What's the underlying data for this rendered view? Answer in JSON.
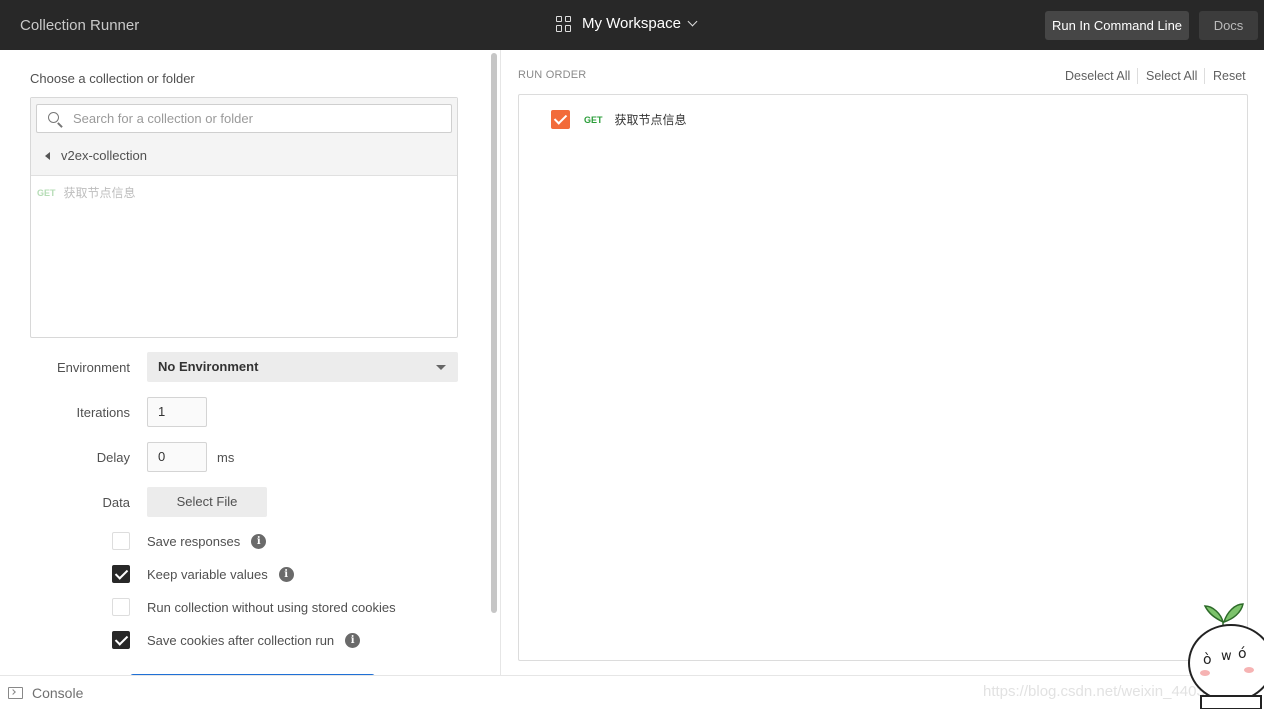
{
  "header": {
    "app_title": "Collection Runner",
    "workspace": "My Workspace",
    "run_cli": "Run In Command Line",
    "docs": "Docs"
  },
  "left": {
    "choose_label": "Choose a collection or folder",
    "search_placeholder": "Search for a collection or folder",
    "collection_name": "v2ex-collection",
    "request": {
      "method": "GET",
      "name": "获取节点信息"
    },
    "environment_label": "Environment",
    "environment_value": "No Environment",
    "iterations_label": "Iterations",
    "iterations_value": "1",
    "delay_label": "Delay",
    "delay_value": "0",
    "delay_unit": "ms",
    "data_label": "Data",
    "select_file": "Select File",
    "options": [
      {
        "label": "Save responses",
        "checked": false,
        "info": true
      },
      {
        "label": "Keep variable values",
        "checked": true,
        "info": true
      },
      {
        "label": "Run collection without using stored cookies",
        "checked": false,
        "info": false
      },
      {
        "label": "Save cookies after collection run",
        "checked": true,
        "info": true
      }
    ],
    "info_glyph": "i"
  },
  "right": {
    "run_order_label": "RUN ORDER",
    "deselect_all": "Deselect All",
    "select_all": "Select All",
    "reset": "Reset",
    "items": [
      {
        "method": "GET",
        "name": "获取节点信息",
        "checked": true
      }
    ]
  },
  "footer": {
    "console": "Console",
    "watermark": "https://blog.csdn.net/weixin_44038"
  },
  "colors": {
    "topbar": "#282828",
    "accent_orange": "#f26b3a",
    "get_green": "#2a9d38",
    "run_blue": "#1f70d6"
  }
}
